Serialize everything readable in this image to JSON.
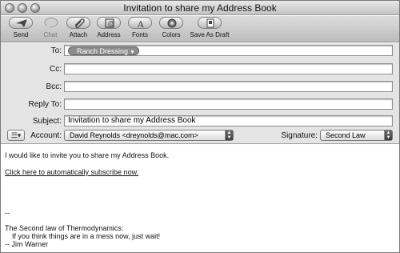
{
  "window": {
    "title": "Invitation to share my Address Book"
  },
  "toolbar": {
    "send": "Send",
    "chat": "Chat",
    "attach": "Attach",
    "address": "Address",
    "fonts": "Fonts",
    "colors": "Colors",
    "save_draft": "Save As Draft"
  },
  "headers": {
    "to_label": "To:",
    "to_token": "Ranch Dressing",
    "cc_label": "Cc:",
    "cc_value": "",
    "bcc_label": "Bcc:",
    "bcc_value": "",
    "reply_to_label": "Reply To:",
    "reply_to_value": "",
    "subject_label": "Subject:",
    "subject_value": "Invitation to share my Address Book",
    "account_label": "Account:",
    "account_value": "David Reynolds <dreynolds@mac.com>",
    "signature_label": "Signature:",
    "signature_value": "Second Law"
  },
  "body": {
    "line1": "I would like to invite you to share my Address Book.",
    "link": "Click here to automatically subscribe now.",
    "sig_sep": "--",
    "sig1": "The Second law of Thermodynamics:",
    "sig2": "If you think things are in a mess now, just wait!",
    "sig3": "-- Jim Warner"
  }
}
